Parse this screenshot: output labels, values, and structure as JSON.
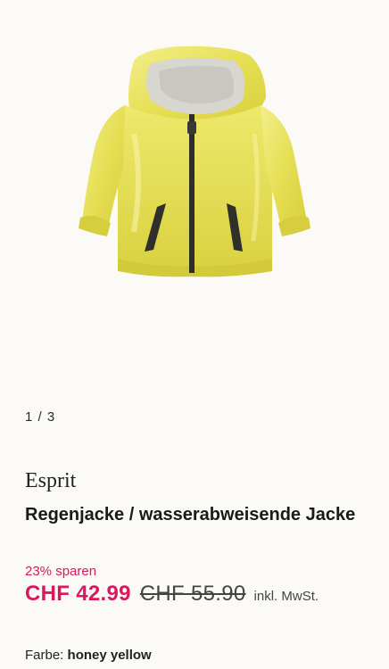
{
  "gallery": {
    "image_alt": "yellow hooded rain jacket",
    "pager": "1 / 3"
  },
  "product": {
    "brand": "Esprit",
    "title": "Regenjacke / wasserabweisende Jacke",
    "savings": "23% sparen",
    "price": "CHF 42.99",
    "old_price": "CHF 55.90",
    "vat_note": "inkl. MwSt.",
    "color_label": "Farbe:",
    "color_value": "honey yellow"
  },
  "colors": {
    "background": "#fbfaf6",
    "sale": "#d8185f",
    "jacket": "#ece76a"
  }
}
